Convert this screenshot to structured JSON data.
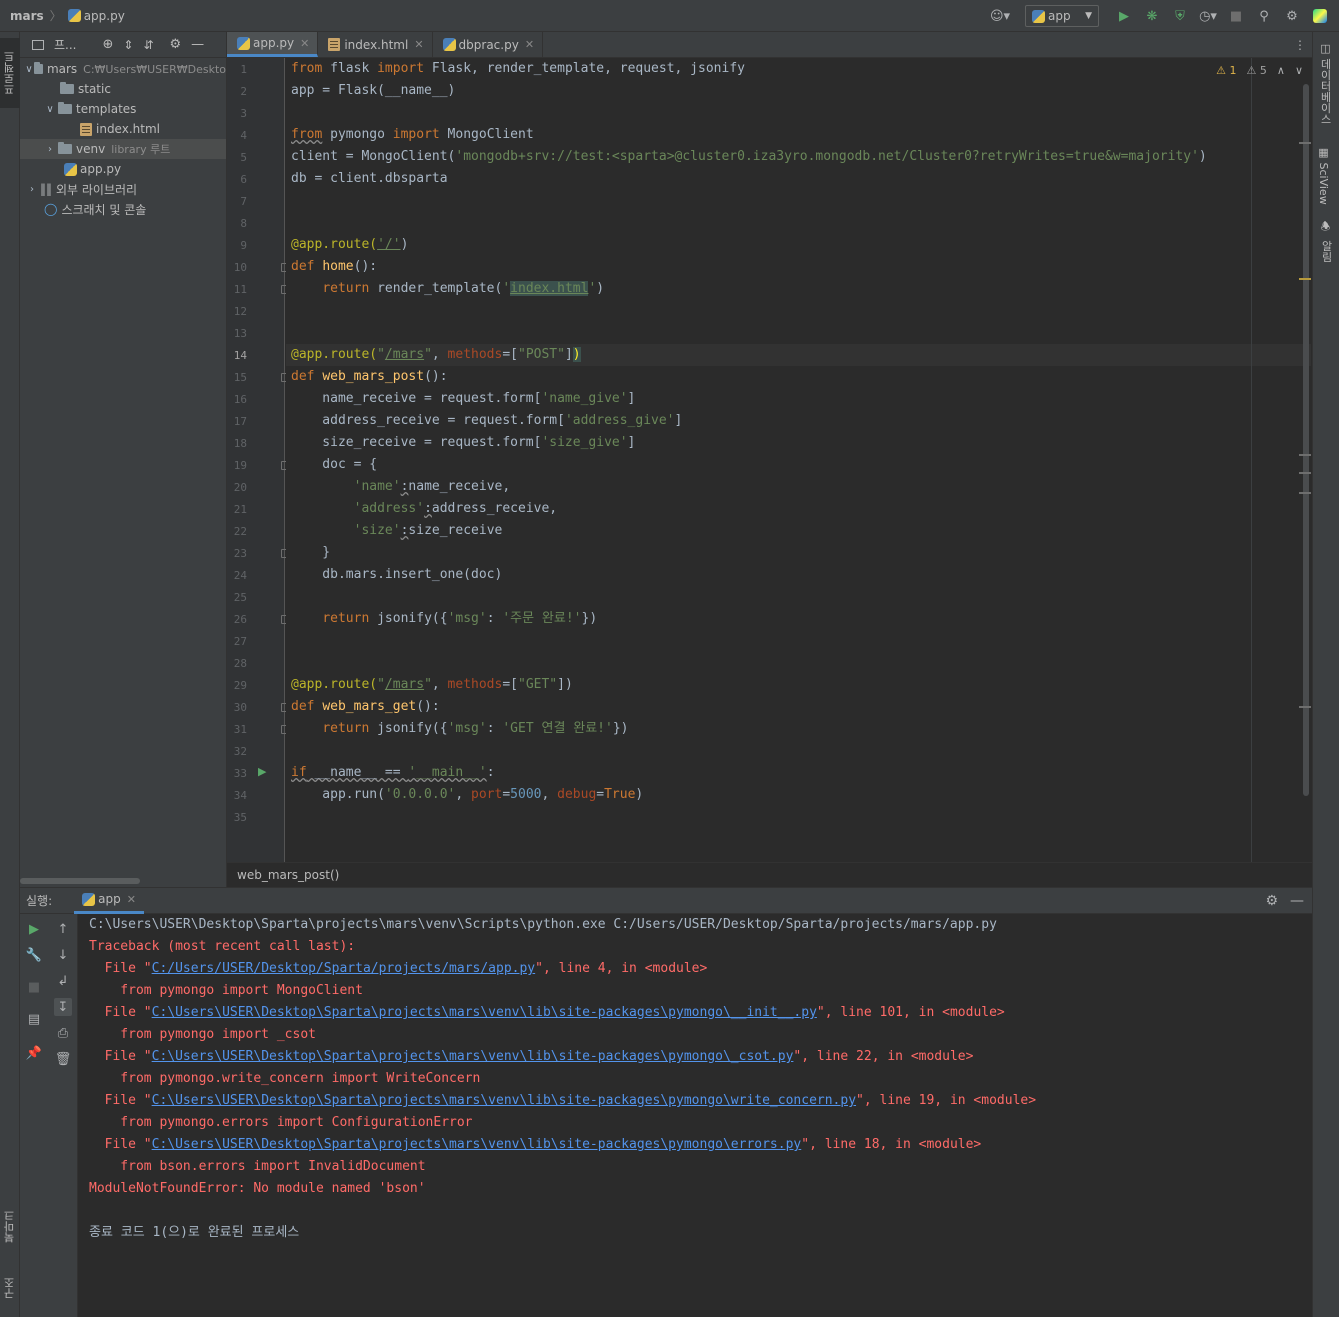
{
  "navbar": {
    "project": "mars",
    "file": "app.py",
    "run_config": "app"
  },
  "left_stripe": {
    "project_tab": "프로젝트",
    "bookmarks_tab": "북마크",
    "structure_tab": "구조"
  },
  "right_stripe": {
    "database_tab": "데이터베이스",
    "sciview_tab": "SciView",
    "notifications_tab": "알림"
  },
  "project_panel": {
    "title": "프...",
    "tree": [
      {
        "label": "mars",
        "hint": "C:₩Users₩USER₩Deskto",
        "type": "folder",
        "depth": 0,
        "expanded": true
      },
      {
        "label": "static",
        "type": "folder",
        "depth": 1
      },
      {
        "label": "templates",
        "type": "folder",
        "depth": 1,
        "expanded": true
      },
      {
        "label": "index.html",
        "type": "html",
        "depth": 2
      },
      {
        "label": "venv",
        "hint": "library 루트",
        "type": "folder",
        "depth": 1,
        "collapsed": true,
        "selected": true
      },
      {
        "label": "app.py",
        "type": "py",
        "depth": 1
      },
      {
        "label": "외부 라이브러리",
        "type": "lib",
        "depth": 0,
        "collapsed": true
      },
      {
        "label": "스크래치 및 콘솔",
        "type": "scratch",
        "depth": 0
      }
    ]
  },
  "editor": {
    "tabs": [
      {
        "label": "app.py",
        "icon": "python-icon",
        "active": true
      },
      {
        "label": "index.html",
        "icon": "html-icon",
        "active": false
      },
      {
        "label": "dbprac.py",
        "icon": "python-icon",
        "active": false
      }
    ],
    "warnings": {
      "weak": "1",
      "other": "5"
    },
    "current_line": 14,
    "line_count": 35,
    "breadcrumb": "web_mars_post()"
  },
  "run_panel": {
    "label": "실행:",
    "tab": "app",
    "output": [
      {
        "kind": "cmd",
        "text": "C:\\Users\\USER\\Desktop\\Sparta\\projects\\mars\\venv\\Scripts\\python.exe C:/Users/USER/Desktop/Sparta/projects/mars/app.py"
      },
      {
        "kind": "err",
        "text": "Traceback (most recent call last):"
      },
      {
        "kind": "file",
        "pre": "  File \"",
        "link": "C:/Users/USER/Desktop/Sparta/projects/mars/app.py",
        "post": "\", line 4, in <module>"
      },
      {
        "kind": "err",
        "text": "    from pymongo import MongoClient"
      },
      {
        "kind": "file",
        "pre": "  File \"",
        "link": "C:\\Users\\USER\\Desktop\\Sparta\\projects\\mars\\venv\\lib\\site-packages\\pymongo\\__init__.py",
        "post": "\", line 101, in <module>"
      },
      {
        "kind": "err",
        "text": "    from pymongo import _csot"
      },
      {
        "kind": "file",
        "pre": "  File \"",
        "link": "C:\\Users\\USER\\Desktop\\Sparta\\projects\\mars\\venv\\lib\\site-packages\\pymongo\\_csot.py",
        "post": "\", line 22, in <module>"
      },
      {
        "kind": "err",
        "text": "    from pymongo.write_concern import WriteConcern"
      },
      {
        "kind": "file",
        "pre": "  File \"",
        "link": "C:\\Users\\USER\\Desktop\\Sparta\\projects\\mars\\venv\\lib\\site-packages\\pymongo\\write_concern.py",
        "post": "\", line 19, in <module>"
      },
      {
        "kind": "err",
        "text": "    from pymongo.errors import ConfigurationError"
      },
      {
        "kind": "file",
        "pre": "  File \"",
        "link": "C:\\Users\\USER\\Desktop\\Sparta\\projects\\mars\\venv\\lib\\site-packages\\pymongo\\errors.py",
        "post": "\", line 18, in <module>"
      },
      {
        "kind": "err",
        "text": "    from bson.errors import InvalidDocument"
      },
      {
        "kind": "err",
        "text": "ModuleNotFoundError: No module named 'bson'"
      },
      {
        "kind": "blank",
        "text": ""
      },
      {
        "kind": "cmd",
        "text": "종료 코드 1(으)로 완료된 프로세스"
      }
    ]
  },
  "code_strings": {
    "l1": [
      "from",
      " flask ",
      "import",
      " Flask, render_template, request, jsonify"
    ],
    "l2": "app = Flask(__name__)",
    "l4": [
      "from",
      " pymongo ",
      "import",
      " MongoClient"
    ],
    "l5_pre": "client = MongoClient(",
    "l5_str": "'mongodb+srv://test:<sparta>@cluster0.iza3yro.mongodb.net/Cluster0?retryWrites=true&w=majority'",
    "l5_post": ")",
    "l6": "db = client.dbsparta",
    "l9_dec": "@app.route(",
    "l9_str": "'/'",
    "l9_post": ")",
    "l10": [
      "def",
      " ",
      "home",
      "():"
    ],
    "l11": [
      "    ",
      "return",
      " render_template(",
      "'",
      "index.html",
      "'",
      ")"
    ],
    "l14": [
      "@app.route(",
      "\"",
      "/mars",
      "\"",
      ", ",
      "methods",
      "=[",
      "\"POST\"",
      "]",
      ")"
    ],
    "l15": [
      "def",
      " ",
      "web_mars_post",
      "():"
    ],
    "l16": [
      "    name_receive = request.form[",
      "'name_give'",
      "]"
    ],
    "l17": [
      "    address_receive = request.form[",
      "'address_give'",
      "]"
    ],
    "l18": [
      "    size_receive = request.form[",
      "'size_give'",
      "]"
    ],
    "l19": "    doc = {",
    "l20": [
      "        ",
      "'name'",
      ":",
      "name_receive,"
    ],
    "l21": [
      "        ",
      "'address'",
      ":",
      "address_receive,"
    ],
    "l22": [
      "        ",
      "'size'",
      ":",
      "size_receive"
    ],
    "l23": "    }",
    "l24": "    db.mars.insert_one(doc)",
    "l26": [
      "    ",
      "return",
      " jsonify({",
      "'msg'",
      ": ",
      "'주문 완료!'",
      "})"
    ],
    "l29": [
      "@app.route(",
      "\"",
      "/mars",
      "\"",
      ", ",
      "methods",
      "=[",
      "\"GET\"",
      "])"
    ],
    "l30": [
      "def",
      " ",
      "web_mars_get",
      "():"
    ],
    "l31": [
      "    ",
      "return",
      " jsonify({",
      "'msg'",
      ": ",
      "'GET 연결 완료!'",
      "})"
    ],
    "l33": [
      "if",
      " __name__ == ",
      "'__main__'",
      ":"
    ],
    "l34": [
      "    app.run(",
      "'0.0.0.0'",
      ", ",
      "port",
      "=",
      "5000",
      ", ",
      "debug",
      "=",
      "True",
      ")"
    ]
  },
  "colors": {
    "keyword": "#cc7832",
    "string": "#6a8759",
    "decorator": "#bbb529",
    "function": "#ffc66d",
    "number": "#6897bb",
    "error": "#ff6b68",
    "link": "#5394ec"
  }
}
